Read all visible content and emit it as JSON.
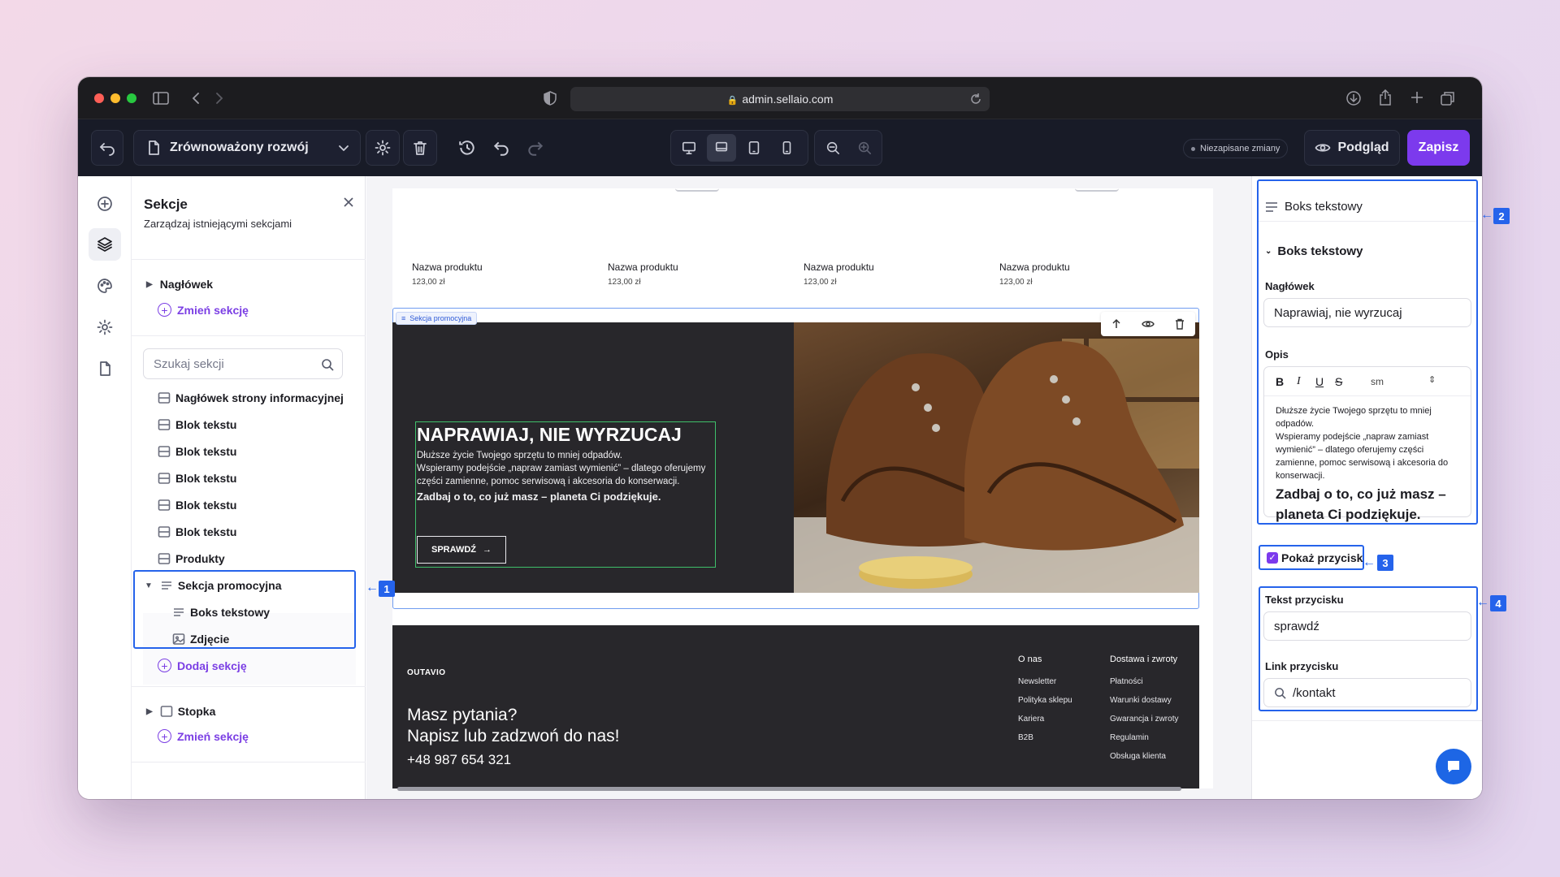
{
  "browser": {
    "url": "admin.sellaio.com"
  },
  "toolbar": {
    "page_name": "Zrównoważony rozwój",
    "unsaved": "Niezapisane zmiany",
    "preview_label": "Podgląd",
    "save_label": "Zapisz"
  },
  "sections_panel": {
    "title": "Sekcje",
    "subtitle": "Zarządzaj istniejącymi sekcjami",
    "header_label": "Nagłówek",
    "change_section": "Zmień sekcję",
    "search_placeholder": "Szukaj sekcji",
    "items": [
      "Nagłówek strony informacyjnej",
      "Blok tekstu",
      "Blok tekstu",
      "Blok tekstu",
      "Blok tekstu",
      "Blok tekstu",
      "Produkty",
      "Sekcja promocyjna"
    ],
    "children": [
      "Boks tekstowy",
      "Zdjęcie"
    ],
    "add_section": "Dodaj sekcję",
    "footer_label": "Stopka",
    "footer_change": "Zmień sekcję"
  },
  "preview": {
    "products": [
      {
        "name": "Nazwa produktu",
        "price": "123,00 zł"
      },
      {
        "name": "Nazwa produktu",
        "price": "123,00 zł"
      },
      {
        "name": "Nazwa produktu",
        "price": "123,00 zł"
      },
      {
        "name": "Nazwa produktu",
        "price": "123,00 zł"
      }
    ],
    "promo_tag": "Sekcja promocyjna",
    "promo_heading": "NAPRAWIAJ, NIE WYRZUCAJ",
    "promo_line1": "Dłuższe życie Twojego sprzętu to mniej odpadów.",
    "promo_line2": "Wspieramy podejście „napraw zamiast wymienić” – dlatego oferujemy części zamienne, pomoc serwisową i akcesoria do konserwacji.",
    "promo_bold": "Zadbaj o to, co już masz – planeta Ci podziękuje.",
    "promo_button": "SPRAWDŹ",
    "footer_brand": "OUTAVIO",
    "footer_q1": "Masz pytania?",
    "footer_q2": "Napisz lub zadzwoń do nas!",
    "footer_phone": "+48 987 654 321",
    "col1_title": "O nas",
    "col1_links": [
      "Newsletter",
      "Polityka sklepu",
      "Kariera",
      "B2B"
    ],
    "col2_title": "Dostawa i zwroty",
    "col2_links": [
      "Płatności",
      "Warunki dostawy",
      "Gwarancja i zwroty",
      "Regulamin",
      "Obsługa klienta"
    ]
  },
  "inspector": {
    "panel_title": "Boks tekstowy",
    "group_title": "Boks tekstowy",
    "heading_label": "Nagłówek",
    "heading_value": "Naprawiaj, nie wyrzucaj",
    "desc_label": "Opis",
    "size_value": "sm",
    "desc_line1": "Dłuższe życie Twojego sprzętu to mniej odpadów.",
    "desc_line2": "Wspieramy podejście „napraw zamiast wymienić” – dlatego oferujemy części zamienne, pomoc serwisową i akcesoria do konserwacji.",
    "desc_bold": "Zadbaj o to, co już masz – planeta Ci podziękuje.",
    "show_button_label": "Pokaż przycisk",
    "show_button_checked": true,
    "button_text_label": "Tekst przycisku",
    "button_text_value": "sprawdź",
    "button_link_label": "Link przycisku",
    "button_link_value": "/kontakt"
  },
  "callouts": [
    "1",
    "2",
    "3",
    "4"
  ]
}
